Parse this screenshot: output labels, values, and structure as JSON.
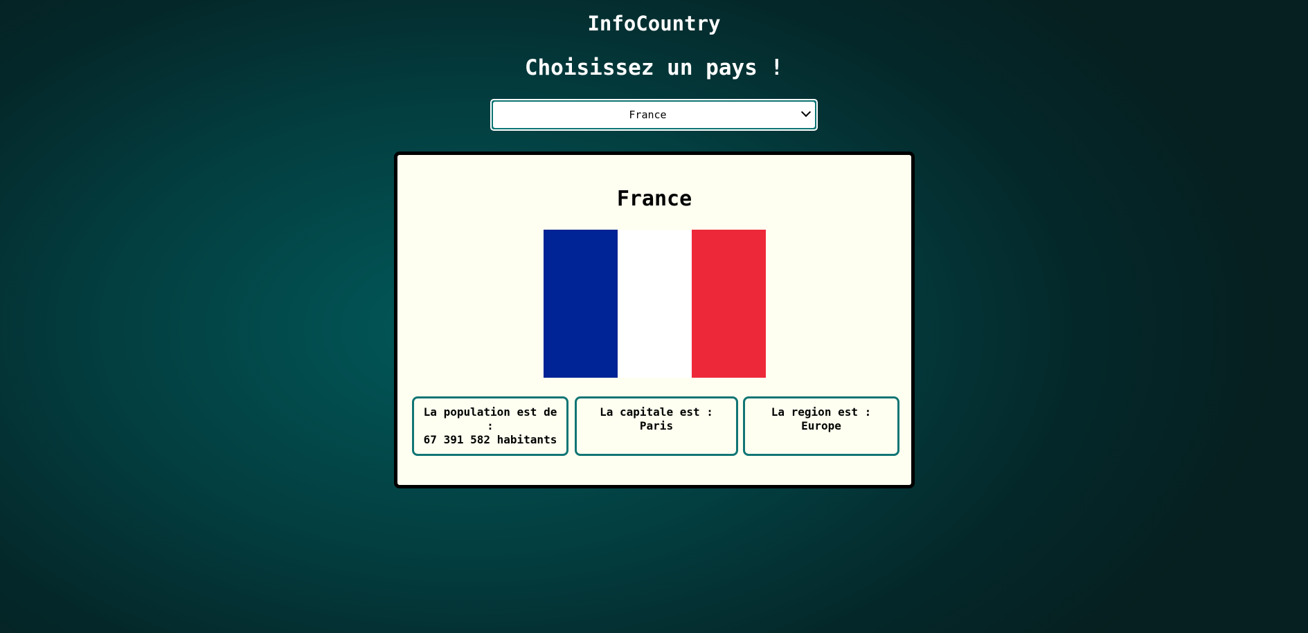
{
  "app": {
    "title": "InfoCountry",
    "subtitle": "Choisissez un pays !"
  },
  "country_select": {
    "selected": "France",
    "icon": "chevron-down-icon"
  },
  "country": {
    "name": "France",
    "flag": {
      "colors": [
        "#002395",
        "#ffffff",
        "#ed2939"
      ]
    },
    "population": {
      "label": "La population est de :",
      "value": "67 391 582 habitants"
    },
    "capital": {
      "label": "La capitale est :",
      "value": "Paris"
    },
    "region": {
      "label": "La region est :",
      "value": "Europe"
    }
  },
  "colors": {
    "background": "#034a4b",
    "card": "#fefff0",
    "accent": "#117575"
  }
}
